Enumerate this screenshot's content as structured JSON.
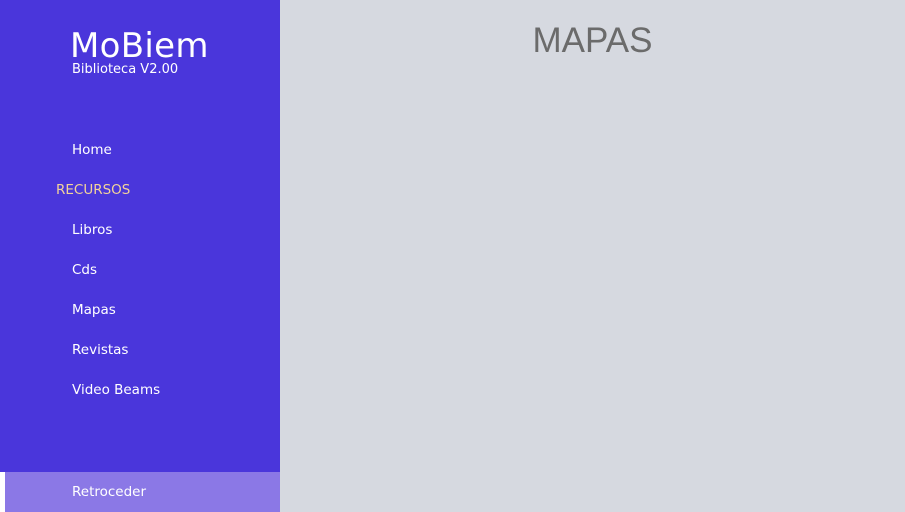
{
  "brand": {
    "title": "MoBiem",
    "subtitle": "Biblioteca V2.00"
  },
  "nav": {
    "home": "Home",
    "section_label": "RECURSOS",
    "items": [
      {
        "label": "Libros"
      },
      {
        "label": "Cds"
      },
      {
        "label": "Mapas"
      },
      {
        "label": "Revistas"
      },
      {
        "label": "Video Beams"
      }
    ],
    "back": "Retroceder"
  },
  "main": {
    "title": "MAPAS"
  },
  "colors": {
    "sidebar_bg": "#4a36db",
    "section_label": "#f2d39a",
    "back_bar_bg": "#8b78e6",
    "content_bg": "#d6d9e0",
    "title_text": "#6b6b6b"
  }
}
